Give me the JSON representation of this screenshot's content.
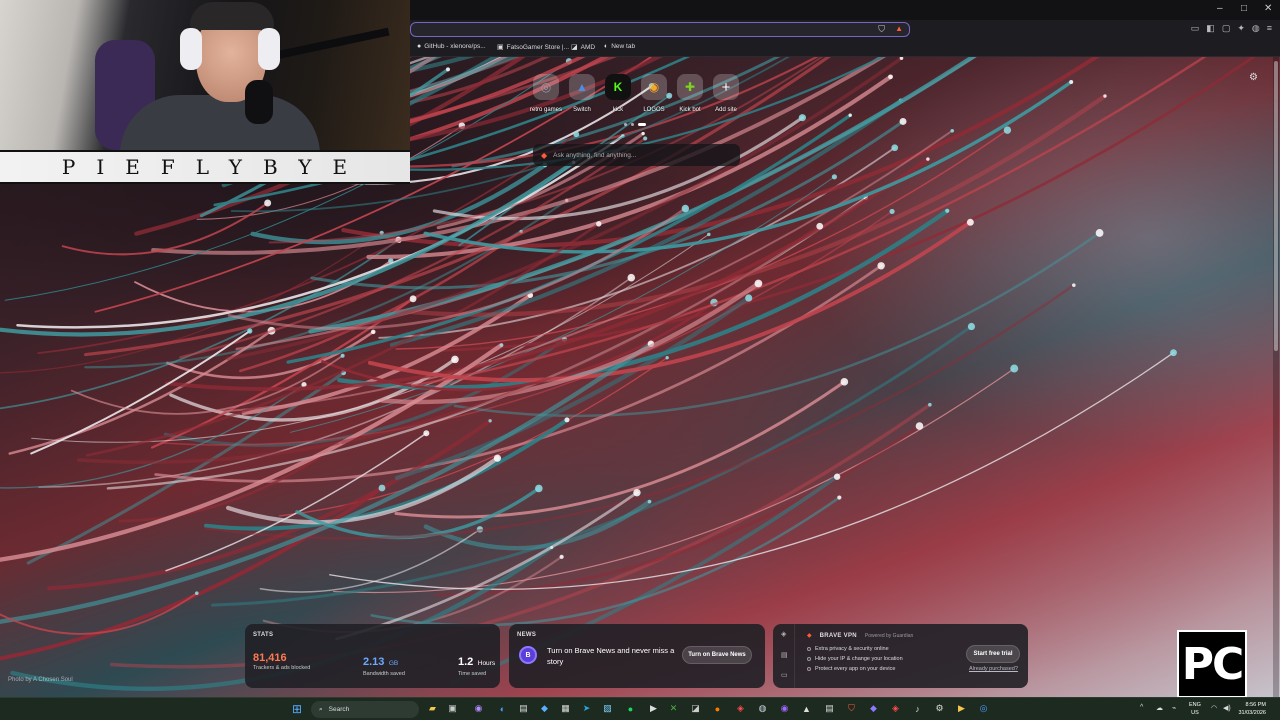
{
  "window": {
    "minimize": "–",
    "maximize": "□",
    "close": "✕"
  },
  "bookmarks": [
    {
      "label": "GitHub - xlenore/ps...",
      "icon": "github-icon"
    },
    {
      "label": "FatsoGamer Store |...",
      "icon": "store-icon"
    },
    {
      "label": "AMD",
      "icon": "amd-icon"
    },
    {
      "label": "New tab",
      "icon": "globe-icon"
    }
  ],
  "webcam": {
    "nameplate": "PIEFLYBYE"
  },
  "top_sites": [
    {
      "label": "retro games",
      "glyph": "◎",
      "color": "#9a9aa6"
    },
    {
      "label": "Switch",
      "glyph": "▲",
      "color": "#4a90e2"
    },
    {
      "label": "kick",
      "glyph": "K",
      "color": "#53fc18"
    },
    {
      "label": "LOGOS",
      "glyph": "◉",
      "color": "#f5a623"
    },
    {
      "label": "Kick bot",
      "glyph": "✚",
      "color": "#7ed321"
    },
    {
      "label": "Add site",
      "glyph": "+",
      "color": "#ffffff"
    }
  ],
  "search": {
    "placeholder": "Ask anything, find anything..."
  },
  "photo_credit": "Photo by A Chosen Soul",
  "stats": {
    "title": "STATS",
    "trackers_value": "81,416",
    "trackers_label": "Trackers & ads blocked",
    "bandwidth_value": "2.13",
    "bandwidth_unit": "GB",
    "bandwidth_label": "Bandwidth saved",
    "time_value": "1.2",
    "time_unit": "Hours",
    "time_label": "Time saved"
  },
  "news": {
    "title": "NEWS",
    "avatar": "B",
    "text": "Turn on Brave News and never miss a story",
    "button": "Turn on Brave News"
  },
  "vpn": {
    "title": "BRAVE VPN",
    "powered_by": "Powered by Guardian",
    "features": [
      "Extra privacy & security online",
      "Hide your IP & change your location",
      "Protect every app on your device"
    ],
    "button": "Start free trial",
    "link": "Already purchased?"
  },
  "pc_logo": "PC",
  "taskbar": {
    "search_label": "Search",
    "lang_1": "ENG",
    "lang_2": "US",
    "time": "8:56 PM",
    "date": "31/03/2026"
  },
  "colors": {
    "accent": "#7a63c9",
    "brave_orange": "#ff5b3a",
    "stats_orange": "#ff7a50",
    "stats_blue": "#6fa8ff"
  }
}
